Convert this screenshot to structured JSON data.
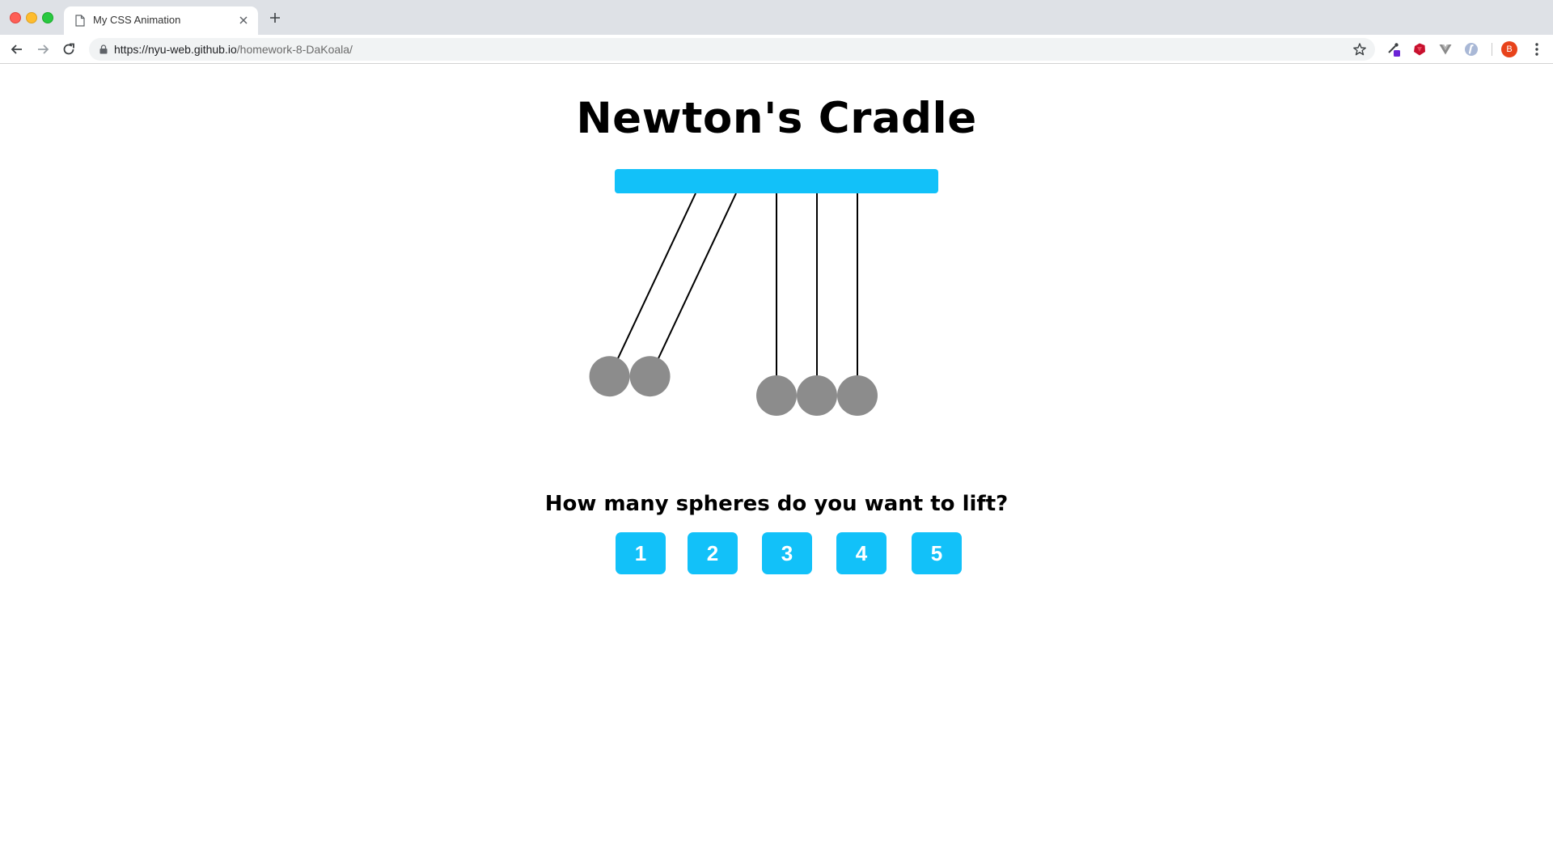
{
  "browser": {
    "tab_title": "My CSS Animation",
    "url_host": "https://nyu-web.github.io",
    "url_path": "/homework-8-DaKoala/",
    "profile_initial": "B"
  },
  "page": {
    "title": "Newton's Cradle",
    "question": "How many spheres do you want to lift?",
    "buttons": [
      "1",
      "2",
      "3",
      "4",
      "5"
    ],
    "lifted_spheres": 2,
    "sphere_count": 5
  },
  "colors": {
    "accent": "#12c1f9",
    "sphere": "#8c8c8c",
    "string": "#000000"
  }
}
